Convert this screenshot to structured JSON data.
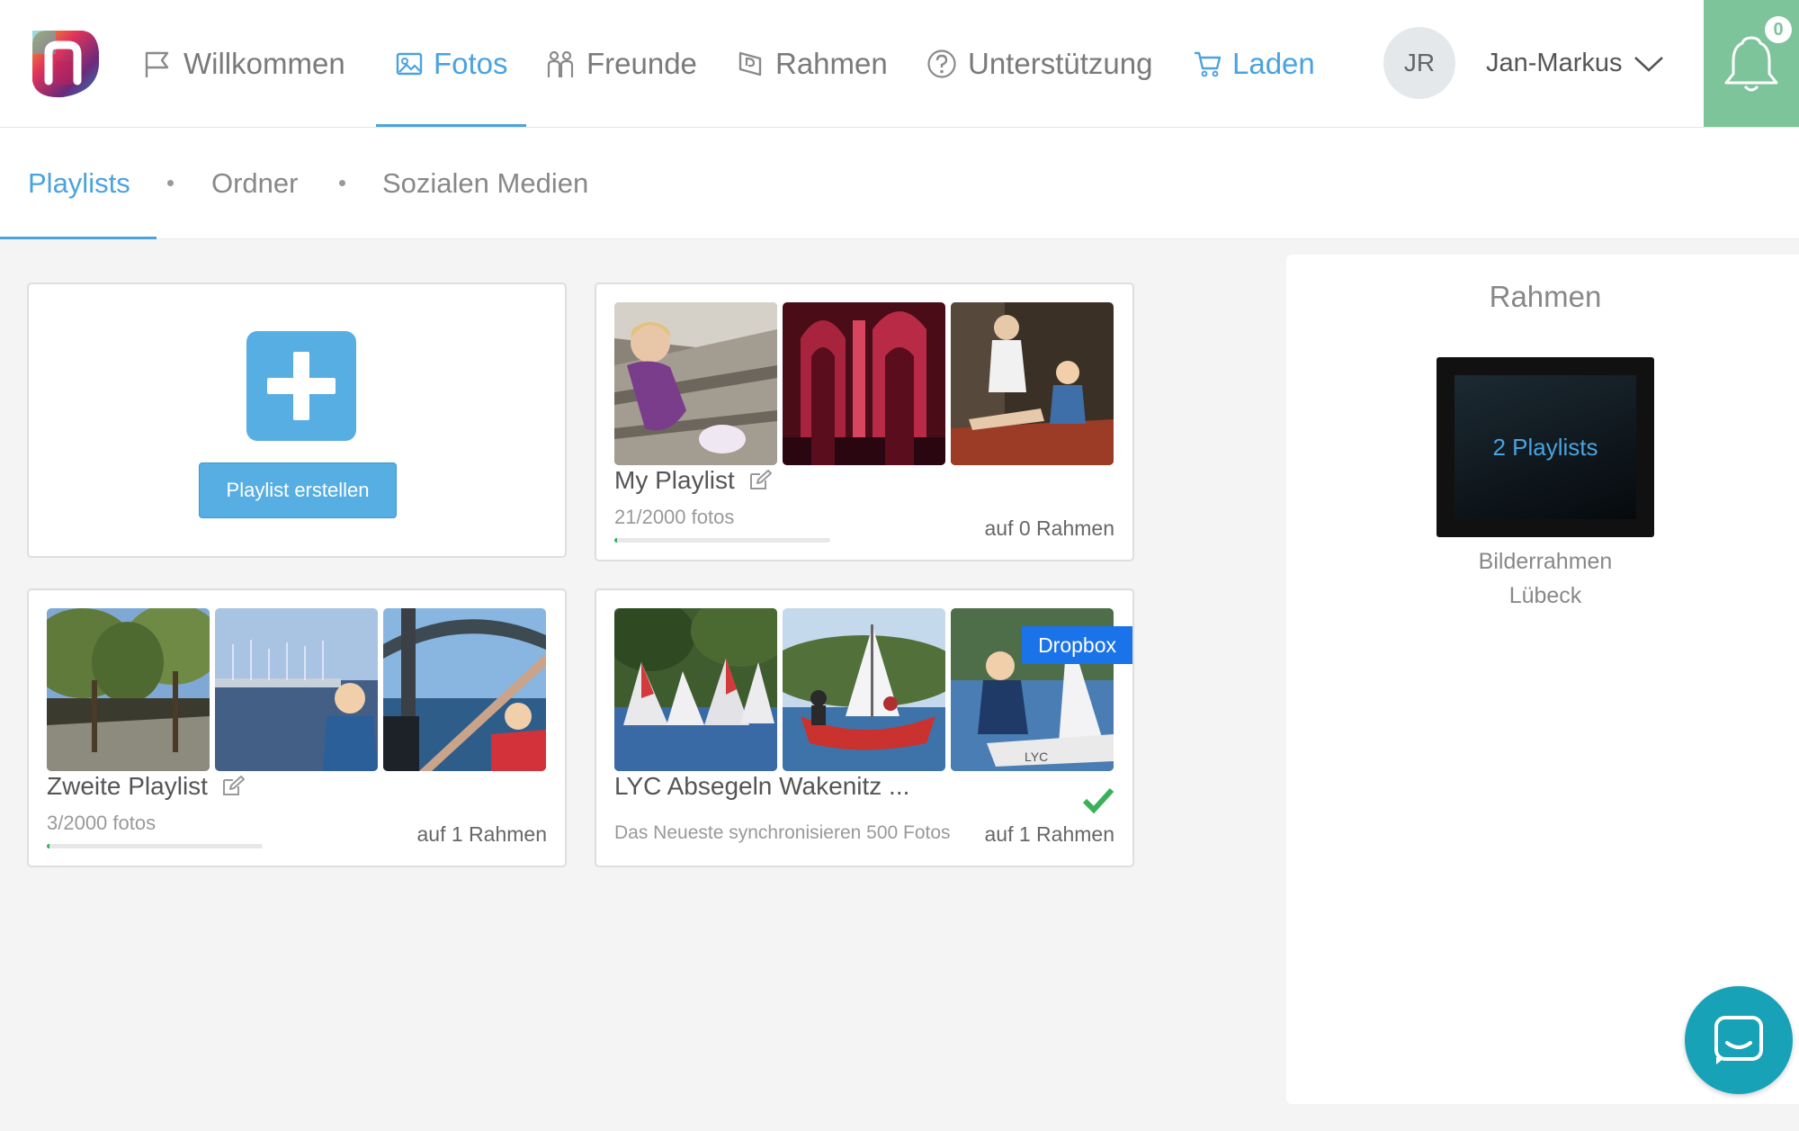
{
  "nav": {
    "items": [
      {
        "label": "Willkommen",
        "icon": "flag-icon"
      },
      {
        "label": "Fotos",
        "icon": "photo-icon"
      },
      {
        "label": "Freunde",
        "icon": "friends-icon"
      },
      {
        "label": "Rahmen",
        "icon": "frame-icon"
      },
      {
        "label": "Unterstützung",
        "icon": "help-icon"
      },
      {
        "label": "Laden",
        "icon": "cart-icon"
      }
    ],
    "user_initials": "JR",
    "user_name": "Jan-Markus",
    "notification_count": "0",
    "accent": "#4aa3df",
    "notif_bg": "#7dc49a"
  },
  "subtabs": [
    "Playlists",
    "Ordner",
    "Sozialen Medien"
  ],
  "create": {
    "button_label": "Playlist erstellen"
  },
  "playlists": [
    {
      "title": "My Playlist",
      "count": "21/2000 fotos",
      "frames": "auf 0 Rahmen",
      "progress": 0.0105
    },
    {
      "title": "Zweite Playlist",
      "count": "3/2000 fotos",
      "frames": "auf 1 Rahmen",
      "progress": 0.0015
    },
    {
      "title": "LYC Absegeln Wakenitz ...",
      "sync": "Das Neueste synchronisieren 500 Fotos",
      "frames": "auf 1 Rahmen",
      "badge": "Dropbox",
      "synced": true
    }
  ],
  "side": {
    "title": "Rahmen",
    "frame_playlists": "2 Playlists",
    "frame_name": "Bilderrahmen",
    "frame_location": "Lübeck"
  }
}
